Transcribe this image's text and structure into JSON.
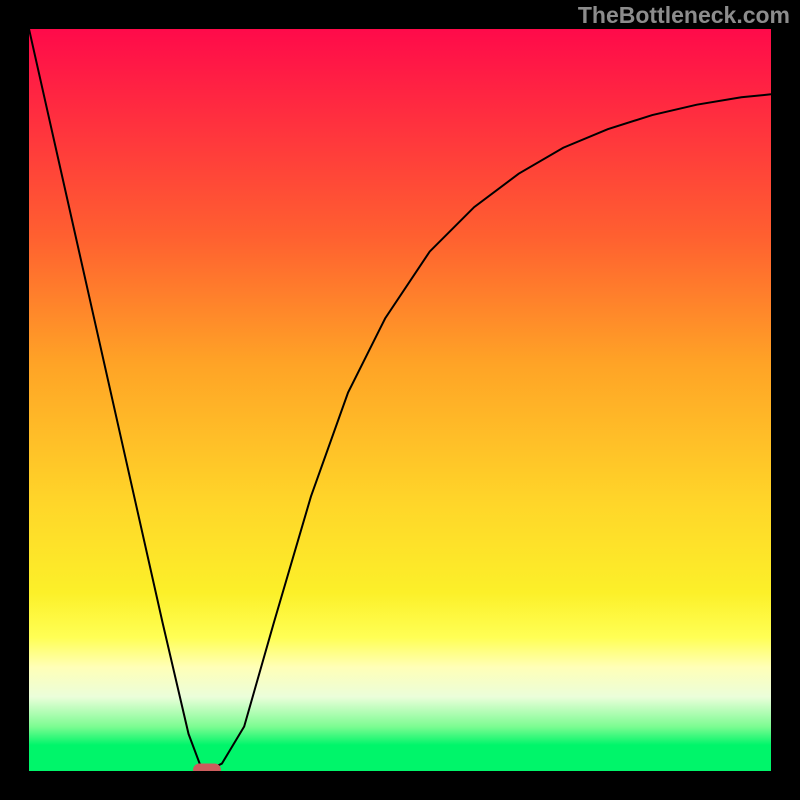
{
  "watermark": "TheBottleneck.com",
  "chart_data": {
    "type": "line",
    "title": "",
    "xlabel": "",
    "ylabel": "",
    "xlim": [
      0,
      1
    ],
    "ylim": [
      0,
      1
    ],
    "series": [
      {
        "name": "curve",
        "x": [
          0.0,
          0.045,
          0.09,
          0.135,
          0.18,
          0.215,
          0.23,
          0.24,
          0.26,
          0.29,
          0.33,
          0.38,
          0.43,
          0.48,
          0.54,
          0.6,
          0.66,
          0.72,
          0.78,
          0.84,
          0.9,
          0.96,
          1.0
        ],
        "y": [
          1.0,
          0.8,
          0.6,
          0.4,
          0.2,
          0.05,
          0.01,
          0.0,
          0.01,
          0.06,
          0.2,
          0.37,
          0.51,
          0.61,
          0.7,
          0.76,
          0.805,
          0.84,
          0.865,
          0.884,
          0.898,
          0.908,
          0.912
        ]
      }
    ],
    "marker": {
      "x": 0.24,
      "y": 0.002
    },
    "colors": {
      "curve": "#000000",
      "marker": "#cc5d5d",
      "frame": "#000000",
      "gradient_top": "#ff0a4a",
      "gradient_bottom": "#00f56a"
    }
  }
}
